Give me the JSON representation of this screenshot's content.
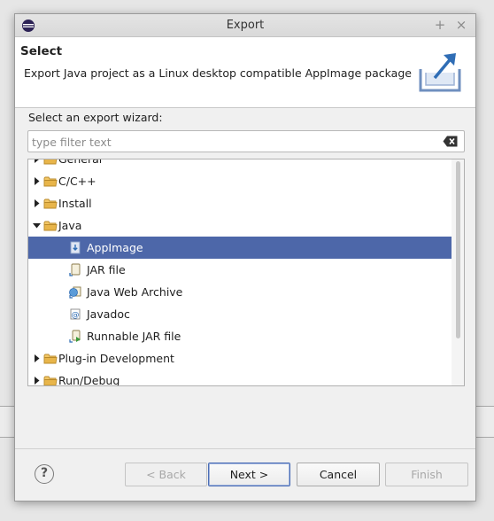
{
  "window": {
    "title": "Export",
    "controls": [
      "+",
      "×"
    ]
  },
  "header": {
    "title": "Select",
    "description": "Export Java project as a Linux desktop compatible AppImage package"
  },
  "wizard": {
    "label": "Select an export wizard:",
    "filter_placeholder": "type filter text",
    "filter_value": ""
  },
  "tree": {
    "items": [
      {
        "label": "General",
        "level": 0,
        "expanded": false,
        "icon": "folder-icon"
      },
      {
        "label": "C/C++",
        "level": 0,
        "expanded": false,
        "icon": "folder-icon"
      },
      {
        "label": "Install",
        "level": 0,
        "expanded": false,
        "icon": "folder-icon"
      },
      {
        "label": "Java",
        "level": 0,
        "expanded": true,
        "icon": "folder-icon"
      },
      {
        "label": "AppImage",
        "level": 1,
        "selected": true,
        "icon": "appimage-icon"
      },
      {
        "label": "JAR file",
        "level": 1,
        "icon": "jar-file-icon"
      },
      {
        "label": "Java Web Archive",
        "level": 1,
        "icon": "web-archive-icon"
      },
      {
        "label": "Javadoc",
        "level": 1,
        "icon": "javadoc-icon"
      },
      {
        "label": "Runnable JAR file",
        "level": 1,
        "icon": "runnable-jar-icon"
      },
      {
        "label": "Plug-in Development",
        "level": 0,
        "expanded": false,
        "icon": "folder-icon"
      },
      {
        "label": "Run/Debug",
        "level": 0,
        "expanded": false,
        "icon": "folder-icon"
      }
    ]
  },
  "buttons": {
    "help": "?",
    "back": "< Back",
    "next": "Next >",
    "cancel": "Cancel",
    "finish": "Finish"
  },
  "colors": {
    "selection": "#4d67a9",
    "folder": "#e8b54a",
    "accent": "#2f6db5"
  }
}
